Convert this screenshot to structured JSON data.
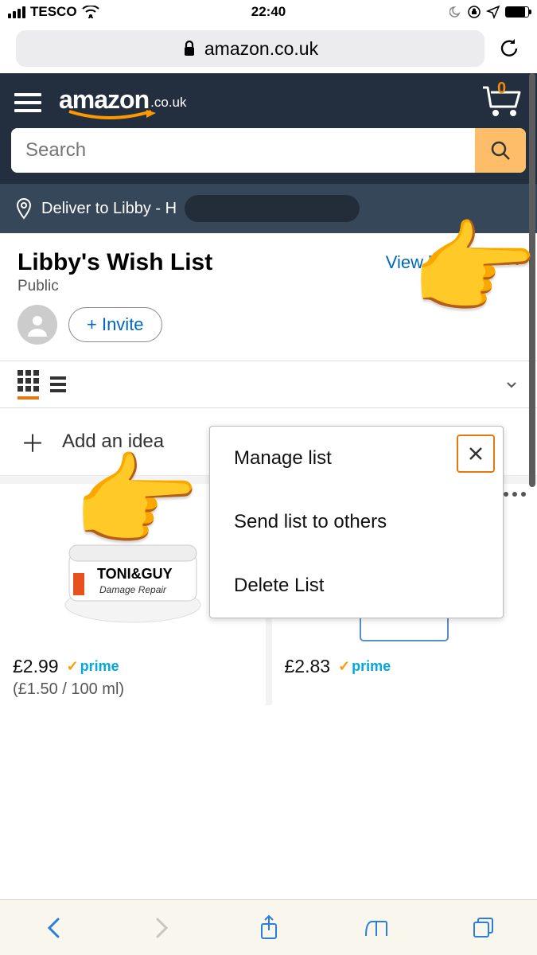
{
  "status": {
    "carrier": "TESCO",
    "time": "22:40"
  },
  "browser": {
    "domain": "amazon.co.uk"
  },
  "header": {
    "logo_main": "amazon",
    "logo_suffix": ".co.uk",
    "cart_count": "0",
    "search_placeholder": "Search"
  },
  "delivery": {
    "prefix": "Deliver to Libby - H"
  },
  "wishlist": {
    "title": "Libby's Wish List",
    "visibility": "Public",
    "view_lists": "View lists",
    "invite_label": "+ Invite",
    "add_idea": "Add an idea"
  },
  "popup": {
    "item1": "Manage list",
    "item2": "Send list to others",
    "item3": "Delete List"
  },
  "products": [
    {
      "price": "£2.99",
      "prime": "prime",
      "sub": "(£1.50 / 100 ml)"
    },
    {
      "price": "£2.83",
      "prime": "prime",
      "sub": ""
    }
  ]
}
